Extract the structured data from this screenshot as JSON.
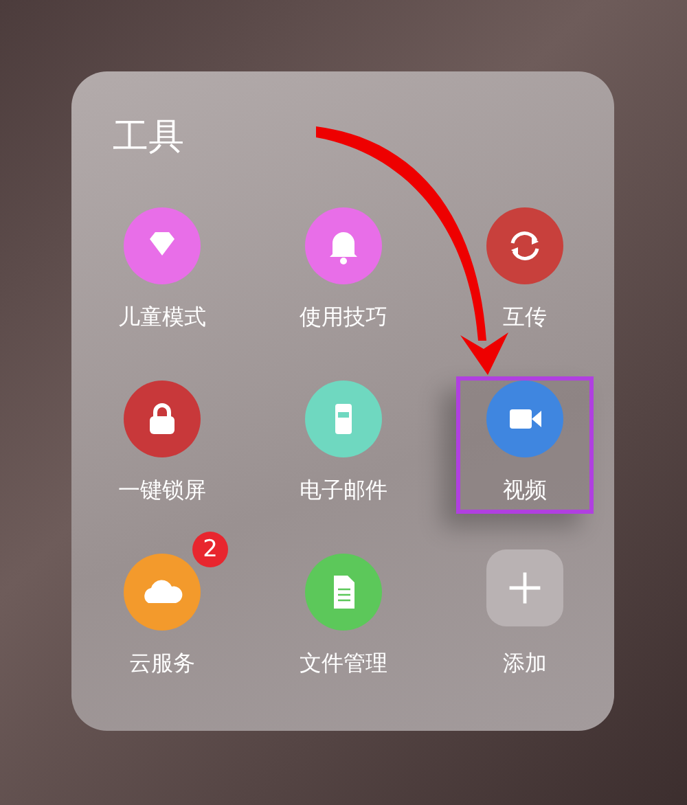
{
  "folder": {
    "title": "工具",
    "apps": [
      {
        "label": "儿童模式",
        "kind": "diamond",
        "color": "#e86ee8",
        "highlighted": false
      },
      {
        "label": "使用技巧",
        "kind": "bell",
        "color": "#e86ee8",
        "highlighted": false
      },
      {
        "label": "互传",
        "kind": "sync",
        "color": "#c8403c",
        "highlighted": false
      },
      {
        "label": "一键锁屏",
        "kind": "lock",
        "color": "#c8383a",
        "highlighted": false
      },
      {
        "label": "电子邮件",
        "kind": "mailbox",
        "color": "#6fd8c0",
        "highlighted": false
      },
      {
        "label": "视频",
        "kind": "video",
        "color": "#3f86e0",
        "highlighted": true
      },
      {
        "label": "云服务",
        "kind": "cloud",
        "color": "#f39a2c",
        "highlighted": false,
        "badge": "2"
      },
      {
        "label": "文件管理",
        "kind": "document",
        "color": "#5cc85a",
        "highlighted": false
      },
      {
        "label": "添加",
        "kind": "add",
        "highlighted": false
      }
    ]
  }
}
